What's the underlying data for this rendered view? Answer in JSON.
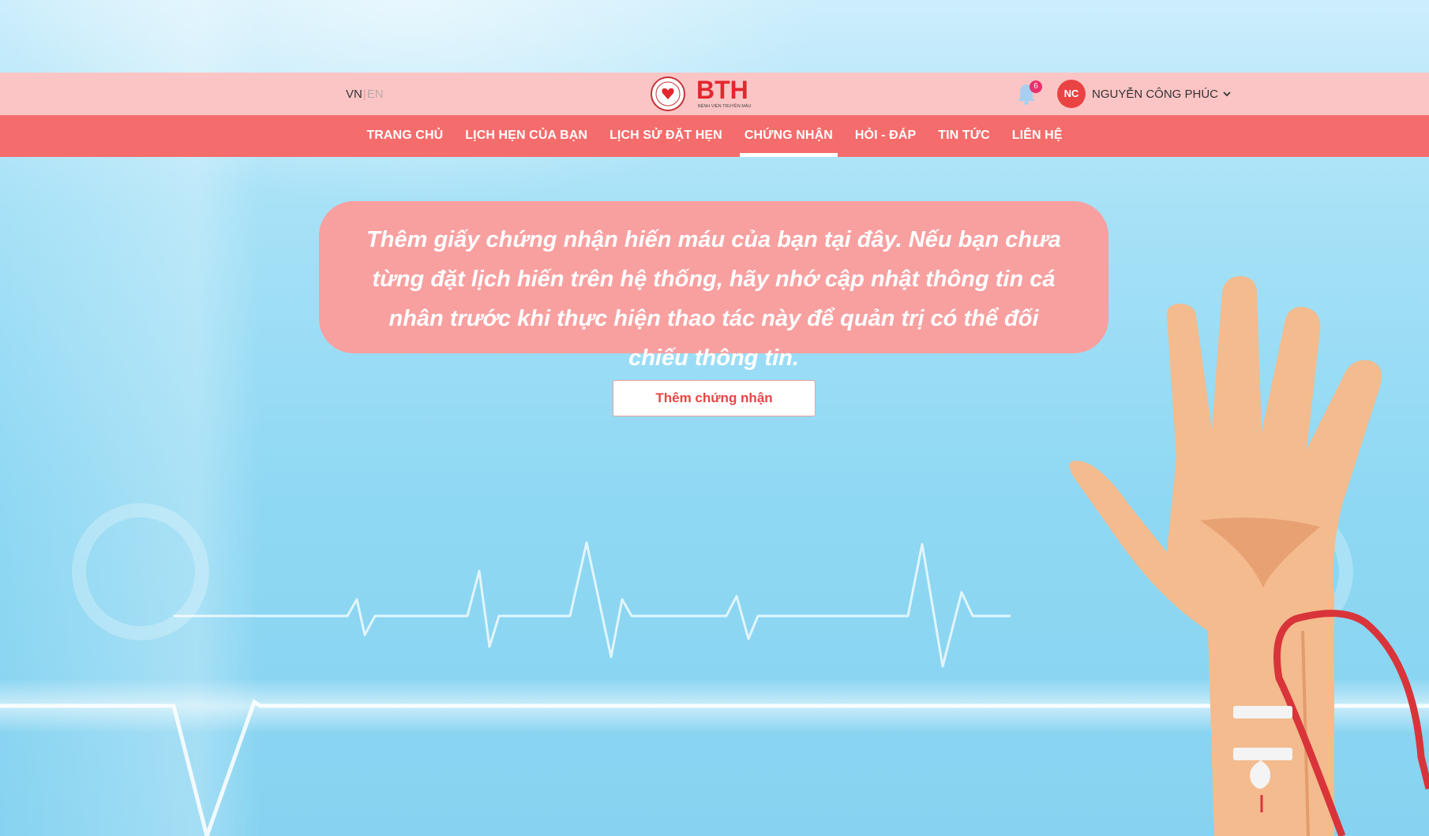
{
  "header": {
    "lang_vn": "VN",
    "lang_sep": "|",
    "lang_en": "EN",
    "notification_count": "6",
    "user_initials": "NC",
    "user_name": "NGUYỄN CÔNG PHÚC",
    "logo_text": "BTH",
    "logo_subtext": "BỆNH VIỆN TRUYỀN MÁU HUYẾT HỌC"
  },
  "nav": {
    "items": [
      {
        "label": "TRANG CHỦ"
      },
      {
        "label": "LỊCH HẸN CỦA BẠN"
      },
      {
        "label": "LỊCH SỬ ĐẶT HẸN"
      },
      {
        "label": "CHỨNG NHẬN",
        "active": true
      },
      {
        "label": "HỎI - ĐÁP"
      },
      {
        "label": "TIN TỨC"
      },
      {
        "label": "LIÊN HỆ"
      }
    ]
  },
  "main": {
    "notice": "Thêm giấy chứng nhận hiến máu của bạn tại đây. Nếu bạn chưa từng đặt lịch hiến trên hệ thống, hãy nhớ cập nhật thông tin cá nhân trước khi thực hiện thao tác này để quản trị có thể đối chiếu thông tin.",
    "add_button": "Thêm chứng nhận"
  },
  "colors": {
    "topbar": "#fcc5c5",
    "navbar": "#f56c6c",
    "notice_bg": "#f8a0a0",
    "accent": "#e84545"
  },
  "icons": [
    "bell-icon",
    "chevron-down-icon",
    "hospital-seal-icon"
  ]
}
